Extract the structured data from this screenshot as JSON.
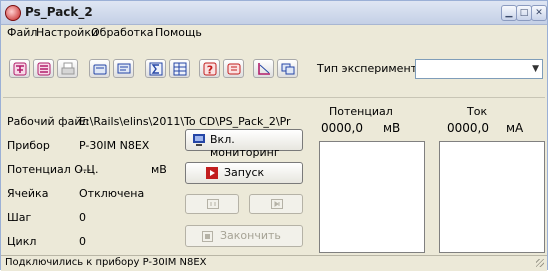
{
  "window": {
    "title": "Ps_Pack_2"
  },
  "menu": [
    "Файл",
    "Настройки",
    "Обработка",
    "Помощь"
  ],
  "toolbar": {
    "icons": [
      "config-device-icon",
      "config-record-icon",
      "print-icon",
      "device-icon",
      "monitor-icon",
      "sum-icon",
      "table-icon",
      "help-icon",
      "calc-icon",
      "chart-icon",
      "windows-icon"
    ],
    "experiment_type_label": "Тип эксперимента",
    "experiment_type_value": ""
  },
  "info": {
    "work_file_label": "Рабочий файл",
    "work_file_value": "E:\\Rails\\elins\\2011\\To CD\\PS_Pack_2\\Pr",
    "device_label": "Прибор",
    "device_value": "P-30IM N8EX",
    "ocp_label": "Потенциал О.Ц.",
    "ocp_value": "---",
    "ocp_unit": "мВ",
    "cell_label": "Ячейка",
    "cell_value": "Отключена",
    "step_label": "Шаг",
    "step_value": "0",
    "cycle_label": "Цикл",
    "cycle_value": "0"
  },
  "controls": {
    "monitor_label": "Вкл. мониторинг",
    "start_label": "Запуск",
    "finish_label": "Закончить"
  },
  "readouts": {
    "potential_title": "Потенциал",
    "potential_value": "0000,0",
    "potential_unit": "мВ",
    "current_title": "Ток",
    "current_value": "0000,0",
    "current_unit": "мА"
  },
  "status": {
    "text": "Подключились к прибору P-30IM N8EX"
  }
}
